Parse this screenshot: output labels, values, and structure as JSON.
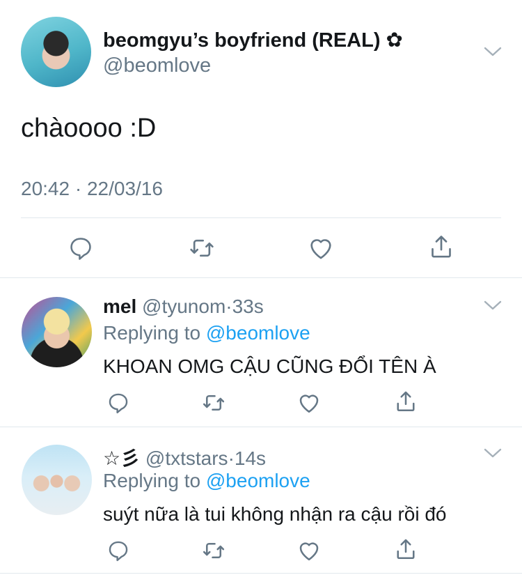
{
  "main_tweet": {
    "display_name": "beomgyu’s boyfriend (REAL) ✿",
    "handle": "@beomlove",
    "text": "chàoooo :D",
    "timestamp": "20:42 · 22/03/16",
    "actions": [
      "reply-icon",
      "retweet-icon",
      "like-icon",
      "share-icon"
    ]
  },
  "replies": [
    {
      "name": "mel",
      "handle": "@tyunom",
      "separator": "·",
      "time": "33s",
      "replying_prefix": "Replying to",
      "replying_to": "@beomlove",
      "text": "KHOAN OMG CẬU CŨNG ĐỔI TÊN À"
    },
    {
      "name": "☆彡",
      "handle": "@txtstars",
      "separator": "·",
      "time": "14s",
      "replying_prefix": "Replying to",
      "replying_to": "@beomlove",
      "text": "suýt nữa là tui không nhận ra cậu rồi đó"
    }
  ],
  "colors": {
    "text": "#14171a",
    "secondary": "#657786",
    "link": "#1da1f2",
    "divider": "#e1e8ed",
    "icon": "#657786"
  }
}
